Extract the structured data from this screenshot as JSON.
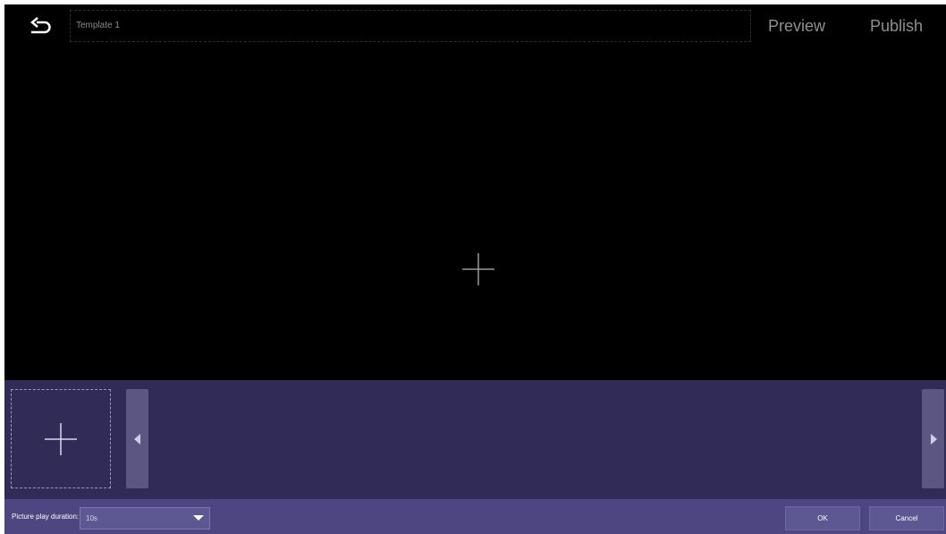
{
  "header": {
    "title": "Template 1",
    "preview_label": "Preview",
    "publish_label": "Publish",
    "back_icon": "back-arrow-icon"
  },
  "canvas": {
    "add_icon": "plus-icon"
  },
  "strip": {
    "add_icon": "plus-icon",
    "prev_icon": "caret-left-icon",
    "next_icon": "caret-right-icon"
  },
  "footer": {
    "duration_label": "Picture play duration:",
    "duration_value": "10s",
    "ok_label": "OK",
    "cancel_label": "Cancel"
  },
  "colors": {
    "canvas_bg": "#000000",
    "strip_bg": "#312c57",
    "footer_bg": "#4d4680",
    "control_bg": "#5d5792"
  }
}
